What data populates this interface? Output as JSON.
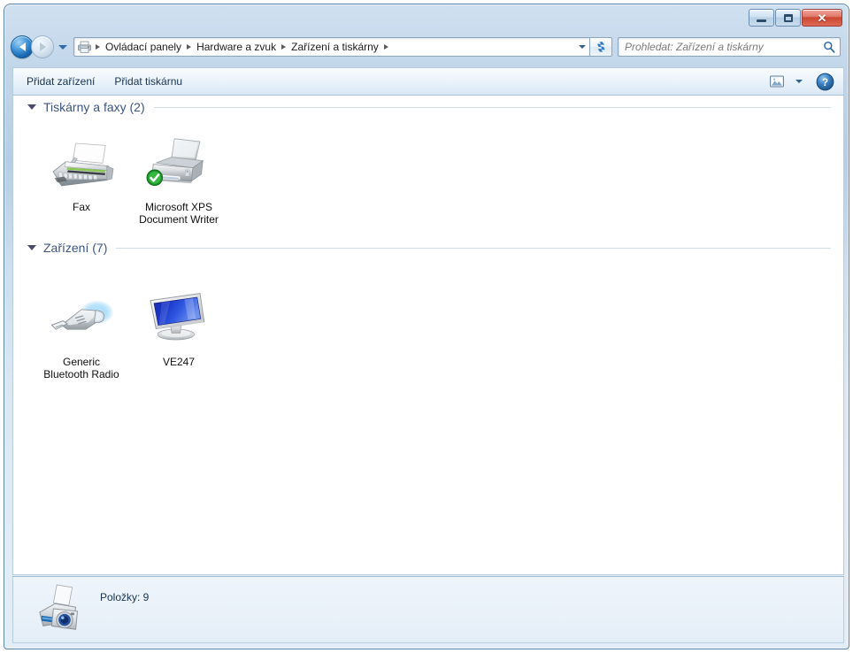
{
  "window": {
    "title": "",
    "controls": {
      "minimize_label": "Minimalizovat",
      "maximize_label": "Maximalizovat",
      "close_label": "Zavřít"
    }
  },
  "navigation": {
    "back_label": "Zpět",
    "forward_label": "Vpřed",
    "history_label": "Poslední umístění",
    "refresh_label": "Obnovit"
  },
  "address_bar": {
    "icon": "printer-icon",
    "breadcrumbs": [
      {
        "label": "Ovládací panely"
      },
      {
        "label": "Hardware a zvuk"
      },
      {
        "label": "Zařízení a tiskárny"
      }
    ],
    "dropdown_label": "Předchozí umístění"
  },
  "search": {
    "placeholder": "Prohledat: Zařízení a tiskárny",
    "value": "",
    "icon": "search-icon"
  },
  "toolbar": {
    "buttons": [
      {
        "label": "Přidat zařízení",
        "name": "add-device-button"
      },
      {
        "label": "Přidat tiskárnu",
        "name": "add-printer-button"
      }
    ],
    "view_icon": "view-layout-icon",
    "view_dropdown_icon": "chevron-down-icon",
    "help_icon": "help-icon",
    "help_label": "?"
  },
  "groups": [
    {
      "name": "printers-and-faxes",
      "title": "Tiskárny a faxy (2)",
      "expanded": true,
      "items": [
        {
          "label": "Fax",
          "icon": "fax-machine-icon",
          "name": "device-fax",
          "default": false
        },
        {
          "label": "Microsoft XPS\nDocument Writer",
          "label_line1": "Microsoft XPS",
          "label_line2": "Document Writer",
          "icon": "printer-icon",
          "name": "device-xps-writer",
          "default": true,
          "badge": "default-check-badge"
        }
      ]
    },
    {
      "name": "devices",
      "title": "Zařízení (7)",
      "expanded": true,
      "items": [
        {
          "label_line1": "Generic",
          "label_line2": "Bluetooth Radio",
          "icon": "usb-bluetooth-dongle-icon",
          "name": "device-generic-bluetooth-radio",
          "default": false
        },
        {
          "label_line1": "VE247",
          "label_line2": "",
          "icon": "lcd-monitor-icon",
          "name": "device-ve247-monitor",
          "default": false
        }
      ]
    }
  ],
  "status_bar": {
    "icon": "printer-camera-icon",
    "text": "Položky: 9"
  },
  "colors": {
    "accent_blue": "#3b5480",
    "frame_blue": "#b6cde5",
    "close_red": "#cc4630",
    "badge_green": "#2eaa33",
    "content_bg": "#ffffff",
    "statusbar_bg": "#eef4fa"
  }
}
